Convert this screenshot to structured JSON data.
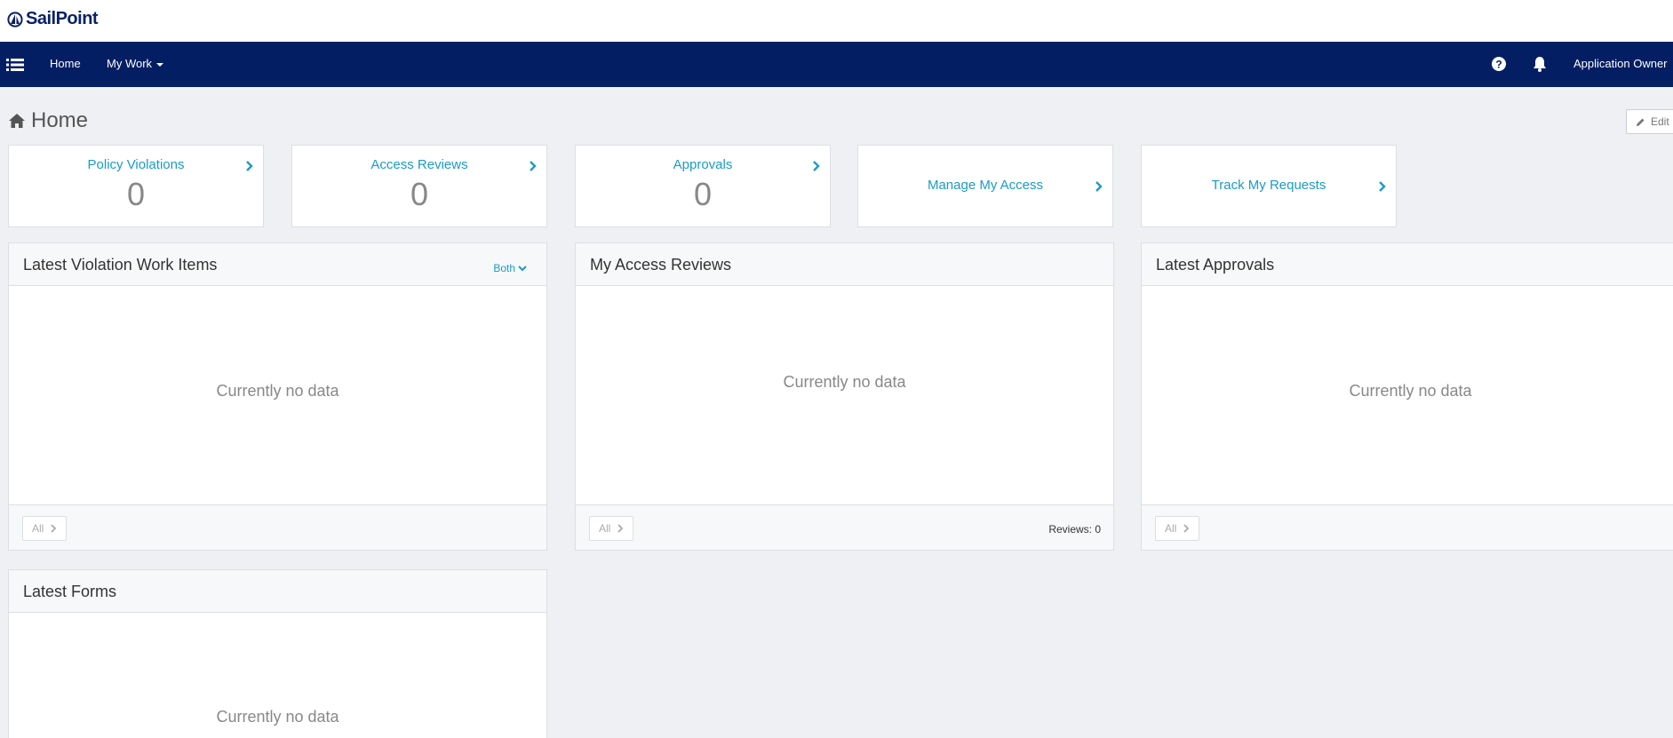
{
  "brand": {
    "name": "SailPoint",
    "color": "#0b2265"
  },
  "nav": {
    "menu_icon": "list-icon",
    "home_label": "Home",
    "my_work_label": "My Work",
    "help_icon": "question-circle-icon",
    "notification_icon": "bell-icon",
    "user_label": "Application Owner",
    "background": "#031e63"
  },
  "page": {
    "title": "Home",
    "edit_label": "Edit"
  },
  "tiles": [
    {
      "label": "Policy Violations",
      "count": "0"
    },
    {
      "label": "Access Reviews",
      "count": "0"
    },
    {
      "label": "Approvals",
      "count": "0"
    },
    {
      "label": "Manage My Access"
    },
    {
      "label": "Track My Requests"
    }
  ],
  "panels": {
    "violations": {
      "title": "Latest Violation Work Items",
      "filter_label": "Both",
      "empty_text": "Currently no data",
      "all_label": "All"
    },
    "reviews": {
      "title": "My Access Reviews",
      "empty_text": "Currently no data",
      "all_label": "All",
      "count_text": "Reviews: 0"
    },
    "approvals": {
      "title": "Latest Approvals",
      "empty_text": "Currently no data",
      "all_label": "All"
    },
    "forms": {
      "title": "Latest Forms",
      "empty_text": "Currently no data"
    }
  },
  "colors": {
    "accent": "#1a9bc7",
    "background": "#eef0f3"
  }
}
